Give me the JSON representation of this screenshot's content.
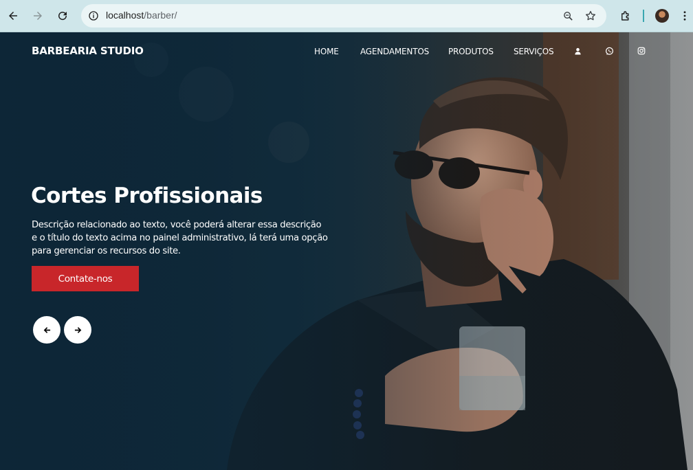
{
  "browser": {
    "url_host": "localhost",
    "url_path": "/barber/"
  },
  "nav": {
    "brand": "BARBEARIA STUDIO",
    "links": [
      "HOME",
      "AGENDAMENTOS",
      "PRODUTOS",
      "SERVIÇOS"
    ],
    "icons": [
      "user-icon",
      "whatsapp-icon",
      "instagram-icon"
    ]
  },
  "hero": {
    "title": "Cortes Profissionais",
    "description_lines": [
      "Descrição relacionado ao texto, você poderá alterar essa descrição",
      "e o título do texto acima no painel administrativo, lá terá uma opção",
      "para gerenciar os recursos do site."
    ],
    "cta_label": "Contate-nos",
    "cta_color": "#c8262a"
  },
  "colors": {
    "overlay": "#0f2a3b",
    "chrome": "#cfe6ea"
  }
}
